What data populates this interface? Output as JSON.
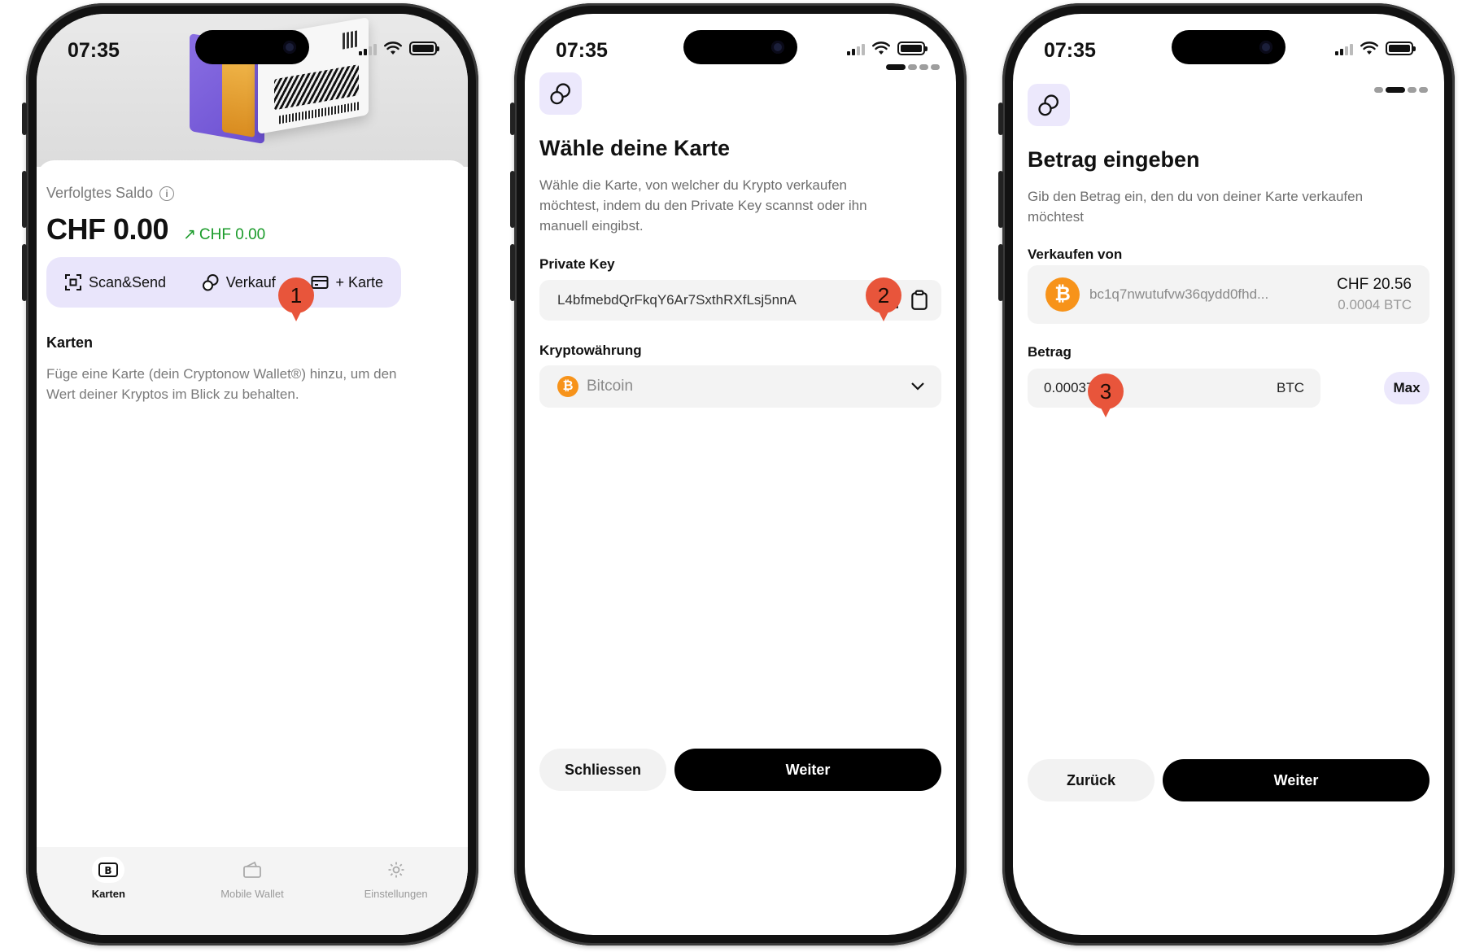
{
  "status_bar": {
    "time": "07:35"
  },
  "screen1": {
    "tracked_label": "Verfolgtes Saldo",
    "info_glyph": "i",
    "balance": "CHF 0.00",
    "delta_arrow": "↗",
    "delta": "CHF 0.00",
    "actions": {
      "scan_send": "Scan&Send",
      "sell": "Verkauf",
      "add_card": "+ Karte"
    },
    "cards_title": "Karten",
    "cards_hint": "Füge eine Karte (dein Cryptonow Wallet®) hinzu, um den Wert deiner Kryptos im Blick zu behalten.",
    "tabs": {
      "cards": "Karten",
      "mobile_wallet": "Mobile Wallet",
      "settings": "Einstellungen"
    },
    "marker": "1"
  },
  "screen2": {
    "title": "Wähle deine Karte",
    "description": "Wähle die Karte, von welcher du Krypto verkaufen möchtest, indem du den Private Key scannst oder ihn manuell eingibst.",
    "private_key_label": "Private Key",
    "private_key_value": "L4bfmebdQrFkqY6Ar7SxthRXfLsj5nnAH",
    "currency_label": "Kryptowährung",
    "currency_value": "Bitcoin",
    "close_button": "Schliessen",
    "next_button": "Weiter",
    "marker": "2"
  },
  "screen3": {
    "title": "Betrag eingeben",
    "description": "Gib den Betrag ein, den du von deiner Karte verkaufen möchtest",
    "sell_from_label": "Verkaufen von",
    "address": "bc1q7nwutufvw36qydd0fhd...",
    "amount_fiat": "CHF 20.56",
    "amount_crypto": "0.0004 BTC",
    "amount_label": "Betrag",
    "amount_value": "0.0003737",
    "amount_unit": "BTC",
    "max_button": "Max",
    "back_button": "Zurück",
    "next_button": "Weiter",
    "marker": "3"
  },
  "colors": {
    "accent_purple": "#E9E5FB",
    "bitcoin_orange": "#F7931A",
    "marker_red": "#E8553B",
    "gain_green": "#1A9B2A"
  }
}
